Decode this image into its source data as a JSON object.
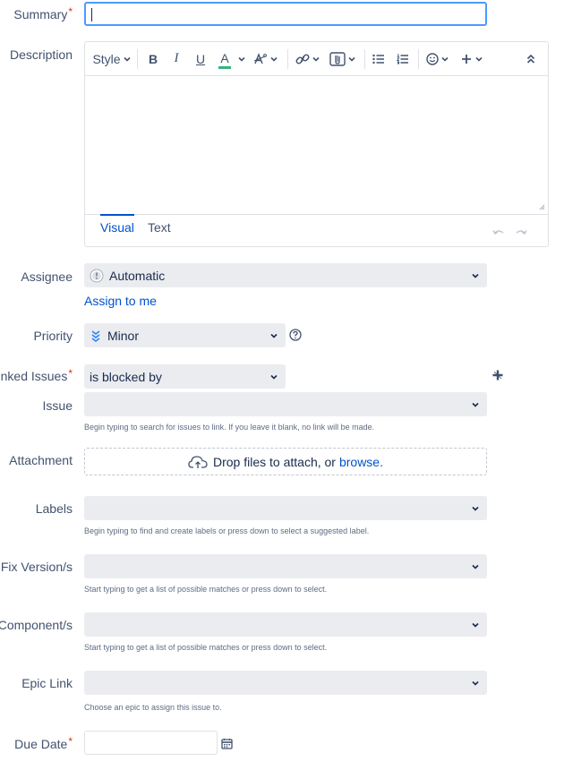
{
  "summary": {
    "label": "Summary",
    "required": "*",
    "value": ""
  },
  "description": {
    "label": "Description",
    "toolbar": {
      "style": "Style",
      "bold": "B",
      "italic": "I",
      "underline": "U",
      "text_color": "A"
    },
    "tabs": {
      "visual": "Visual",
      "text": "Text"
    }
  },
  "assignee": {
    "label": "Assignee",
    "value": "Automatic",
    "assign_to_me": "Assign to me"
  },
  "priority": {
    "label": "Priority",
    "value": "Minor"
  },
  "linked_issues": {
    "label": "Linked Issues",
    "required": "*",
    "value": "is blocked by"
  },
  "issue": {
    "label": "Issue",
    "value": "",
    "hint": "Begin typing to search for issues to link. If you leave it blank, no link will be made."
  },
  "attachment": {
    "label": "Attachment",
    "drop_text": "Drop files to attach, or",
    "browse": "browse."
  },
  "labels": {
    "label": "Labels",
    "value": "",
    "hint": "Begin typing to find and create labels or press down to select a suggested label."
  },
  "fix_versions": {
    "label": "Fix Version/s",
    "value": "",
    "hint": "Start typing to get a list of possible matches or press down to select."
  },
  "components": {
    "label": "Component/s",
    "value": "",
    "hint": "Start typing to get a list of possible matches or press down to select."
  },
  "epic_link": {
    "label": "Epic Link",
    "value": "",
    "hint": "Choose an epic to assign this issue to."
  },
  "due_date": {
    "label": "Due Date",
    "required": "*",
    "value": ""
  },
  "colors": {
    "accent": "#0052cc",
    "focus": "#4c9aff",
    "required": "#de350b",
    "field_bg": "#ebecf0",
    "priority_icon": "#2684ff"
  },
  "icons": [
    "chevron-down-icon",
    "link-icon",
    "attachment-icon",
    "bullet-list-icon",
    "numbered-list-icon",
    "emoji-icon",
    "plus-icon",
    "collapse-icon",
    "undo-icon",
    "redo-icon",
    "avatar-icon",
    "minor-priority-icon",
    "help-icon",
    "add-link-icon",
    "cloud-upload-icon",
    "calendar-icon"
  ]
}
